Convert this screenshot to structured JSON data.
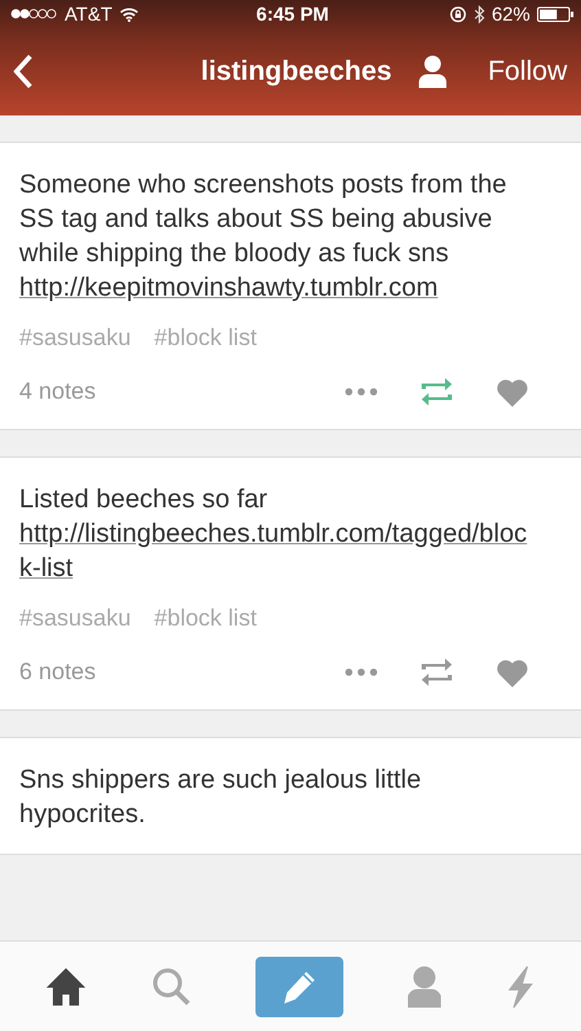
{
  "status_bar": {
    "carrier": "AT&T",
    "time": "6:45 PM",
    "battery": "62%"
  },
  "header": {
    "title": "listingbeeches",
    "follow": "Follow"
  },
  "posts": [
    {
      "text": "Someone who screenshots posts from the SS tag and talks about SS being abusive while shipping the bloody as fuck sns",
      "link": "http://keepitmovinshawty.tumblr.com",
      "tags": [
        "#sasusaku",
        "#block list"
      ],
      "notes": "4 notes",
      "reblogged": true,
      "liked": false
    },
    {
      "text": "Listed beeches so far",
      "link": "http://listingbeeches.tumblr.com/tagged/block-list",
      "tags": [
        "#sasusaku",
        "#block list"
      ],
      "notes": "6 notes",
      "reblogged": false,
      "liked": false
    },
    {
      "text": "Sns shippers are such jealous little hypocrites."
    }
  ],
  "tab_bar": [
    {
      "kind": "home",
      "selected": true
    },
    {
      "kind": "search",
      "selected": false
    },
    {
      "kind": "compose",
      "selected": false
    },
    {
      "kind": "account",
      "selected": false
    },
    {
      "kind": "activity",
      "selected": false
    }
  ]
}
